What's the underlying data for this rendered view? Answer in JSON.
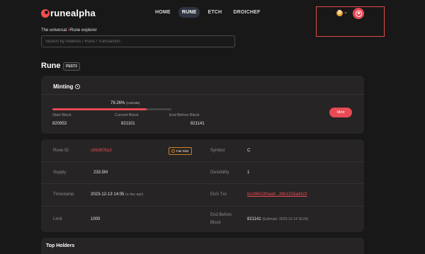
{
  "header": {
    "logo_text": "runealpha",
    "nav": [
      {
        "label": "HOME",
        "active": false
      },
      {
        "label": "RUNE",
        "active": true
      },
      {
        "label": "ETCH",
        "active": false
      },
      {
        "label": "DROICHEF",
        "active": false
      }
    ],
    "coin_symbol": "₿"
  },
  "intro": {
    "tagline_pre": "The universal ",
    "tagline_hash": "#",
    "tagline_post": "Rune explorer",
    "search_placeholder": "Search by Address / Rune / Transaction"
  },
  "rune": {
    "title": "Rune",
    "badge": "PEST3"
  },
  "minting": {
    "title": "Minting",
    "percent_text": "79.26%",
    "progress_detail": "(149/188)",
    "progress_fraction": 0.7926,
    "start_label": "Start Block",
    "start_value": "820953",
    "current_label": "Current Block",
    "current_value": "821101",
    "end_label": "End Before Block",
    "end_value": "821141",
    "mint_button": "Mint"
  },
  "details": {
    "rune_id_label": "Rune ID",
    "rune_id_value": "c86d905a3",
    "fair_mint": "Fair Mint",
    "symbol_label": "Symbol",
    "symbol_value": "C",
    "supply_label": "Supply",
    "supply_value": "233.5M",
    "divisibility_label": "Divisibility",
    "divisibility_value": "1",
    "timestamp_label": "Timestamp",
    "timestamp_value": "2023-12-13 14:05",
    "timestamp_rel": "(a day ago)",
    "etch_label": "Etch Txs",
    "etch_value": "bc2865190aa8...39b1153ad423",
    "limit_label": "Limit",
    "limit_value": "1000",
    "end_before_label_1": "End Before",
    "end_before_label_2": "Block",
    "end_before_value": "821141",
    "end_before_estimate": "(Estimate: 2023-12-14 18:26)"
  },
  "holders": {
    "title": "Top Holders"
  },
  "colors": {
    "accent": "#e84a55",
    "highlight_box": "#e04b4b",
    "background": "#181818",
    "card": "#262424"
  }
}
